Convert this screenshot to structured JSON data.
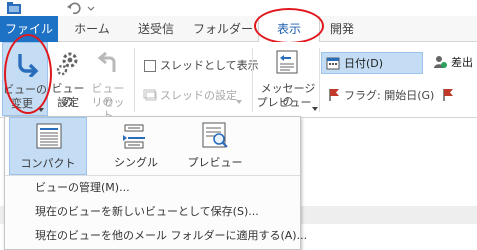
{
  "tabs": {
    "file": "ファイル",
    "home": "ホーム",
    "send_receive": "送受信",
    "folder": "フォルダー",
    "view": "表示",
    "developer": "開発"
  },
  "ribbon": {
    "change_view": {
      "line1": "ビューの",
      "line2": "変更"
    },
    "view_settings": {
      "line1": "ビューの",
      "line2": "設定"
    },
    "reset_view": {
      "line1": "ビューの",
      "line2": "リセット"
    },
    "show_as_threads": "スレッドとして表示",
    "thread_settings": "スレッドの設定",
    "message_preview": {
      "line1": "メッセージの",
      "line2": "プレビュー"
    },
    "sort_date": "日付(D)",
    "sort_sender": "差出",
    "flag_start_date": "フラグ: 開始日(G)"
  },
  "dropdown": {
    "options": [
      "コンパクト",
      "シングル",
      "プレビュー"
    ],
    "selected": "コンパクト",
    "menu": [
      "ビューの管理(M)...",
      "現在のビューを新しいビューとして保存(S)...",
      "現在のビューを他のメール フォルダーに適用する(A)..."
    ]
  },
  "colors": {
    "accent": "#1e72c5",
    "highlight": "#c5ddf4",
    "annotation_ring": "#e0181e",
    "flag": "#c0392b"
  },
  "icons": [
    "outlook-folder-icon",
    "undo-icon",
    "change-view-icon",
    "gear-icon",
    "reset-view-icon",
    "message-preview-icon",
    "calendar-icon",
    "sender-icon",
    "flag-icon",
    "compact-view-icon",
    "single-view-icon",
    "preview-view-icon"
  ]
}
